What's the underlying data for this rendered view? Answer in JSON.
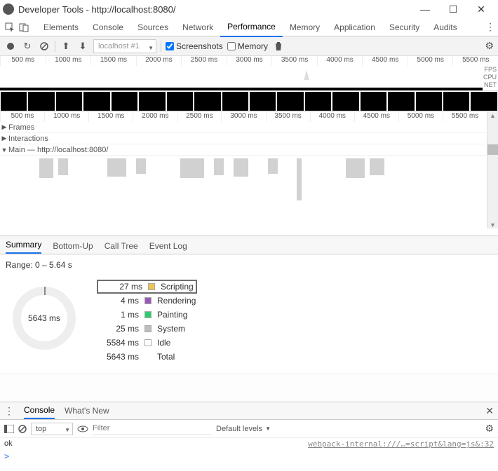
{
  "window": {
    "title": "Developer Tools - http://localhost:8080/",
    "minimize": "—",
    "maximize": "☐",
    "close": "✕"
  },
  "tabs": {
    "items": [
      "Elements",
      "Console",
      "Sources",
      "Network",
      "Performance",
      "Memory",
      "Application",
      "Security",
      "Audits"
    ],
    "active": "Performance"
  },
  "perfToolbar": {
    "recordingSelector": "localhost #1",
    "screenshotsLabel": "Screenshots",
    "screenshotsChecked": true,
    "memoryLabel": "Memory",
    "memoryChecked": false
  },
  "overview": {
    "ticks": [
      "500 ms",
      "1000 ms",
      "1500 ms",
      "2000 ms",
      "2500 ms",
      "3000 ms",
      "3500 ms",
      "4000 ms",
      "4500 ms",
      "5000 ms",
      "5500 ms"
    ],
    "sideLabels": [
      "FPS",
      "CPU",
      "NET"
    ]
  },
  "flame": {
    "ticks": [
      "500 ms",
      "1000 ms",
      "1500 ms",
      "2000 ms",
      "2500 ms",
      "3000 ms",
      "3500 ms",
      "4000 ms",
      "4500 ms",
      "5000 ms",
      "5500 ms"
    ],
    "tracks": {
      "frames": "Frames",
      "interactions": "Interactions",
      "main": "Main — http://localhost:8080/"
    }
  },
  "resultTabs": {
    "items": [
      "Summary",
      "Bottom-Up",
      "Call Tree",
      "Event Log"
    ],
    "active": "Summary"
  },
  "summary": {
    "range": "Range: 0 – 5.64 s",
    "donutTotal": "5643 ms",
    "legend": [
      {
        "value": "27 ms",
        "color": "#f1c453",
        "label": "Scripting",
        "highlight": true
      },
      {
        "value": "4 ms",
        "color": "#9b59b6",
        "label": "Rendering"
      },
      {
        "value": "1 ms",
        "color": "#2ecc71",
        "label": "Painting"
      },
      {
        "value": "25 ms",
        "color": "#bdbdbd",
        "label": "System"
      },
      {
        "value": "5584 ms",
        "color": "#ffffff",
        "label": "Idle"
      },
      {
        "value": "5643 ms",
        "color": "",
        "label": "Total"
      }
    ]
  },
  "drawer": {
    "tabs": [
      "Console",
      "What's New"
    ],
    "active": "Console"
  },
  "consoleToolbar": {
    "context": "top",
    "filterPlaceholder": "Filter",
    "levels": "Default levels"
  },
  "console": {
    "rows": [
      {
        "msg": "ok",
        "src": "webpack-internal:///…=script&lang=js&:32"
      }
    ],
    "prompt": ">"
  },
  "chart_data": {
    "type": "pie",
    "title": "Performance Summary",
    "series": [
      {
        "name": "Scripting",
        "value": 27,
        "unit": "ms"
      },
      {
        "name": "Rendering",
        "value": 4,
        "unit": "ms"
      },
      {
        "name": "Painting",
        "value": 1,
        "unit": "ms"
      },
      {
        "name": "System",
        "value": 25,
        "unit": "ms"
      },
      {
        "name": "Idle",
        "value": 5584,
        "unit": "ms"
      }
    ],
    "total": 5643,
    "range_seconds": [
      0,
      5.64
    ]
  }
}
